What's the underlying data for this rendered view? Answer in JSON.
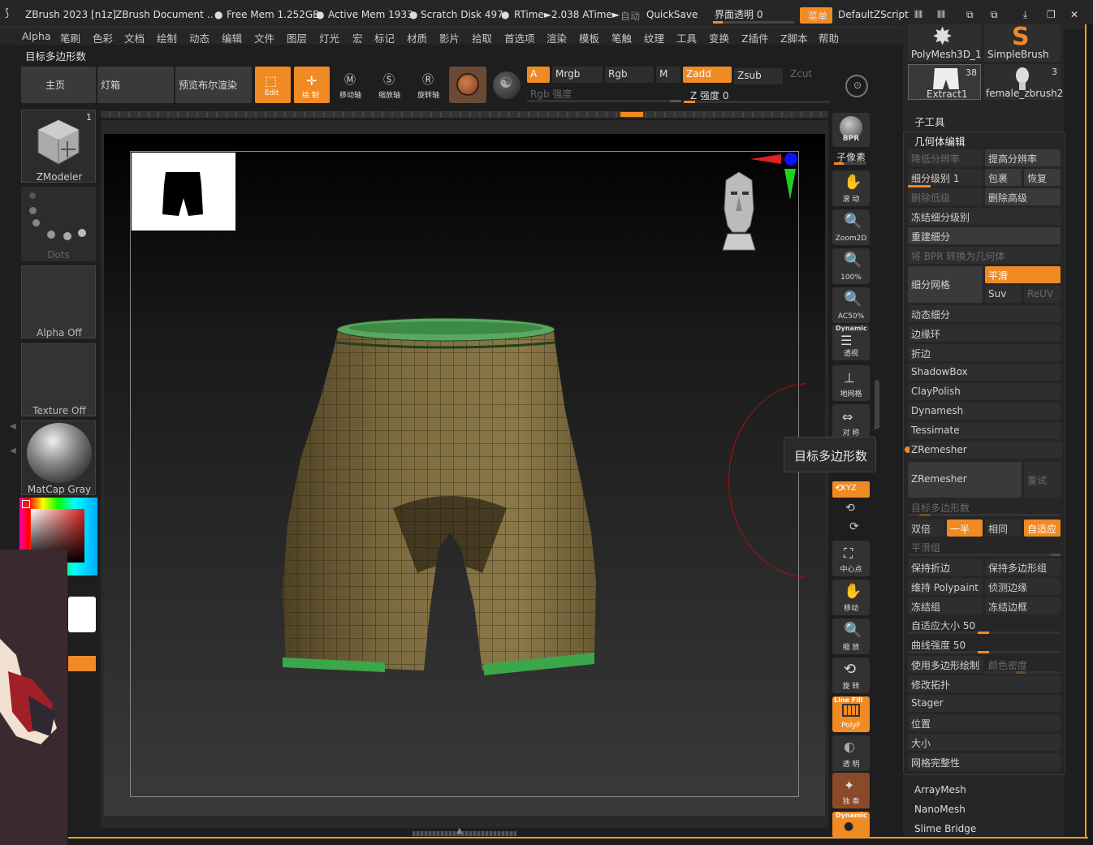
{
  "titlebar": {
    "app": "ZBrush 2023 [n1z]",
    "doc": "ZBrush Document",
    "dots": "..",
    "free_mem": "Free Mem 1.252GB",
    "active_mem": "Active Mem 1933",
    "scratch": "Scratch Disk 497",
    "rtime": "RTime►2.038 ATime►",
    "auto": "自动",
    "quicksave": "QuickSave",
    "transparency": "界面透明 0",
    "menu": "菜单",
    "script": "DefaultZScript"
  },
  "menubar": [
    "Alpha",
    "笔刷",
    "色彩",
    "文档",
    "绘制",
    "动态",
    "编辑",
    "文件",
    "图层",
    "灯光",
    "宏",
    "标记",
    "材质",
    "影片",
    "拾取",
    "首选项",
    "渲染",
    "模板",
    "笔触",
    "纹理",
    "工具",
    "变换",
    "Z插件",
    "Z脚本",
    "帮助"
  ],
  "tooltip_label": "目标多边形数",
  "toolbar": {
    "home": "主页",
    "lightbox": "灯箱",
    "preview_bpr": "预览布尔渲染",
    "edit": "Edit",
    "draw": "绘 制",
    "move": "移动轴",
    "scale": "缩放轴",
    "rotate": "旋转轴",
    "a": "A",
    "mrgb": "Mrgb",
    "rgb": "Rgb",
    "m": "M",
    "zadd": "Zadd",
    "zsub": "Zsub",
    "zcut": "Zcut",
    "rgb_intensity": "Rgb 强度",
    "z_intensity": "Z 强度 0"
  },
  "left_shelf": {
    "brush": "ZModeler",
    "brush_count": "1",
    "stroke": "Dots",
    "alpha": "Alpha Off",
    "texture": "Texture Off",
    "material": "MatCap Gray"
  },
  "viewport_tools": {
    "bpr": "BPR",
    "subpixel": "子像素",
    "scroll": "滚 动",
    "zoom2d": "Zoom2D",
    "z100": "100%",
    "ac50": "AC50%",
    "dynamic": "Dynamic",
    "persp": "透视",
    "floor": "地网格",
    "sym": "对 称",
    "xyz": "XYZ",
    "center": "中心点",
    "move": "移动",
    "scale": "缩 放",
    "rotate": "旋 转",
    "linefill": "Line Fill",
    "polyf": "PolyF",
    "transp": "透 明",
    "solo": "独 奏",
    "dynamic2": "Dynamic"
  },
  "tooltip": "目标多边形数",
  "right_panel": {
    "tools": [
      {
        "name": "PolyMesh3D_1"
      },
      {
        "name": "SimpleBrush"
      },
      {
        "name": "Extract1",
        "count": "38"
      },
      {
        "name": "female_zbrush2",
        "count": "3"
      }
    ],
    "subtool": "子工具",
    "geometry": "几何体编辑",
    "lower_res": "降低分辨率",
    "higher_res": "提高分辨率",
    "sdiv": "细分级别 1",
    "reconstruct": "包裹",
    "restore": "恢复",
    "del_lower": "删除低级",
    "del_higher": "删除高级",
    "freeze_sub": "冻结细分级别",
    "rebuild_sub": "重建细分",
    "bpr_to_geo": "将 BPR 转换为几何体",
    "divide": "细分网格",
    "smooth": "平滑",
    "suv": "Suv",
    "reuv": "ReUV",
    "dynamic_sub": "动态细分",
    "edge_loop": "边缘环",
    "crease": "折边",
    "shadowbox": "ShadowBox",
    "claypolish": "ClayPolish",
    "dynamesh": "Dynamesh",
    "tessimate": "Tessimate",
    "zremesher_title": "ZRemesher",
    "zremesher_btn": "ZRemesher",
    "retry": "重试",
    "target_poly": "目标多边形数",
    "double": "双倍",
    "half": "一半",
    "same": "相同",
    "adaptive": "自适应",
    "smooth_groups": "平滑组",
    "keep_creases": "保持折边",
    "keep_groups": "保持多边形组",
    "keep_polypaint": "维持 Polypaint",
    "detect_edges": "侦测边缘",
    "freeze_groups": "冻结组",
    "freeze_border": "冻结边框",
    "adaptive_size": "自适应大小 50",
    "curve_strength": "曲线强度 50",
    "use_polypaint": "使用多边形绘制",
    "color_density": "颜色密度",
    "modify_topo": "修改拓扑",
    "stager": "Stager",
    "position": "位置",
    "size": "大小",
    "mesh_integrity": "网格完整性",
    "arraymesh": "ArrayMesh",
    "nanomesh": "NanoMesh",
    "slime": "Slime Bridge"
  },
  "colors": {
    "accent": "#f08a24",
    "panel": "#2e2e2e",
    "bg": "#1e1e1e",
    "canvas": "#3a3a3a",
    "mesh": "#7a6a40",
    "edge_green": "#3ca64a"
  }
}
